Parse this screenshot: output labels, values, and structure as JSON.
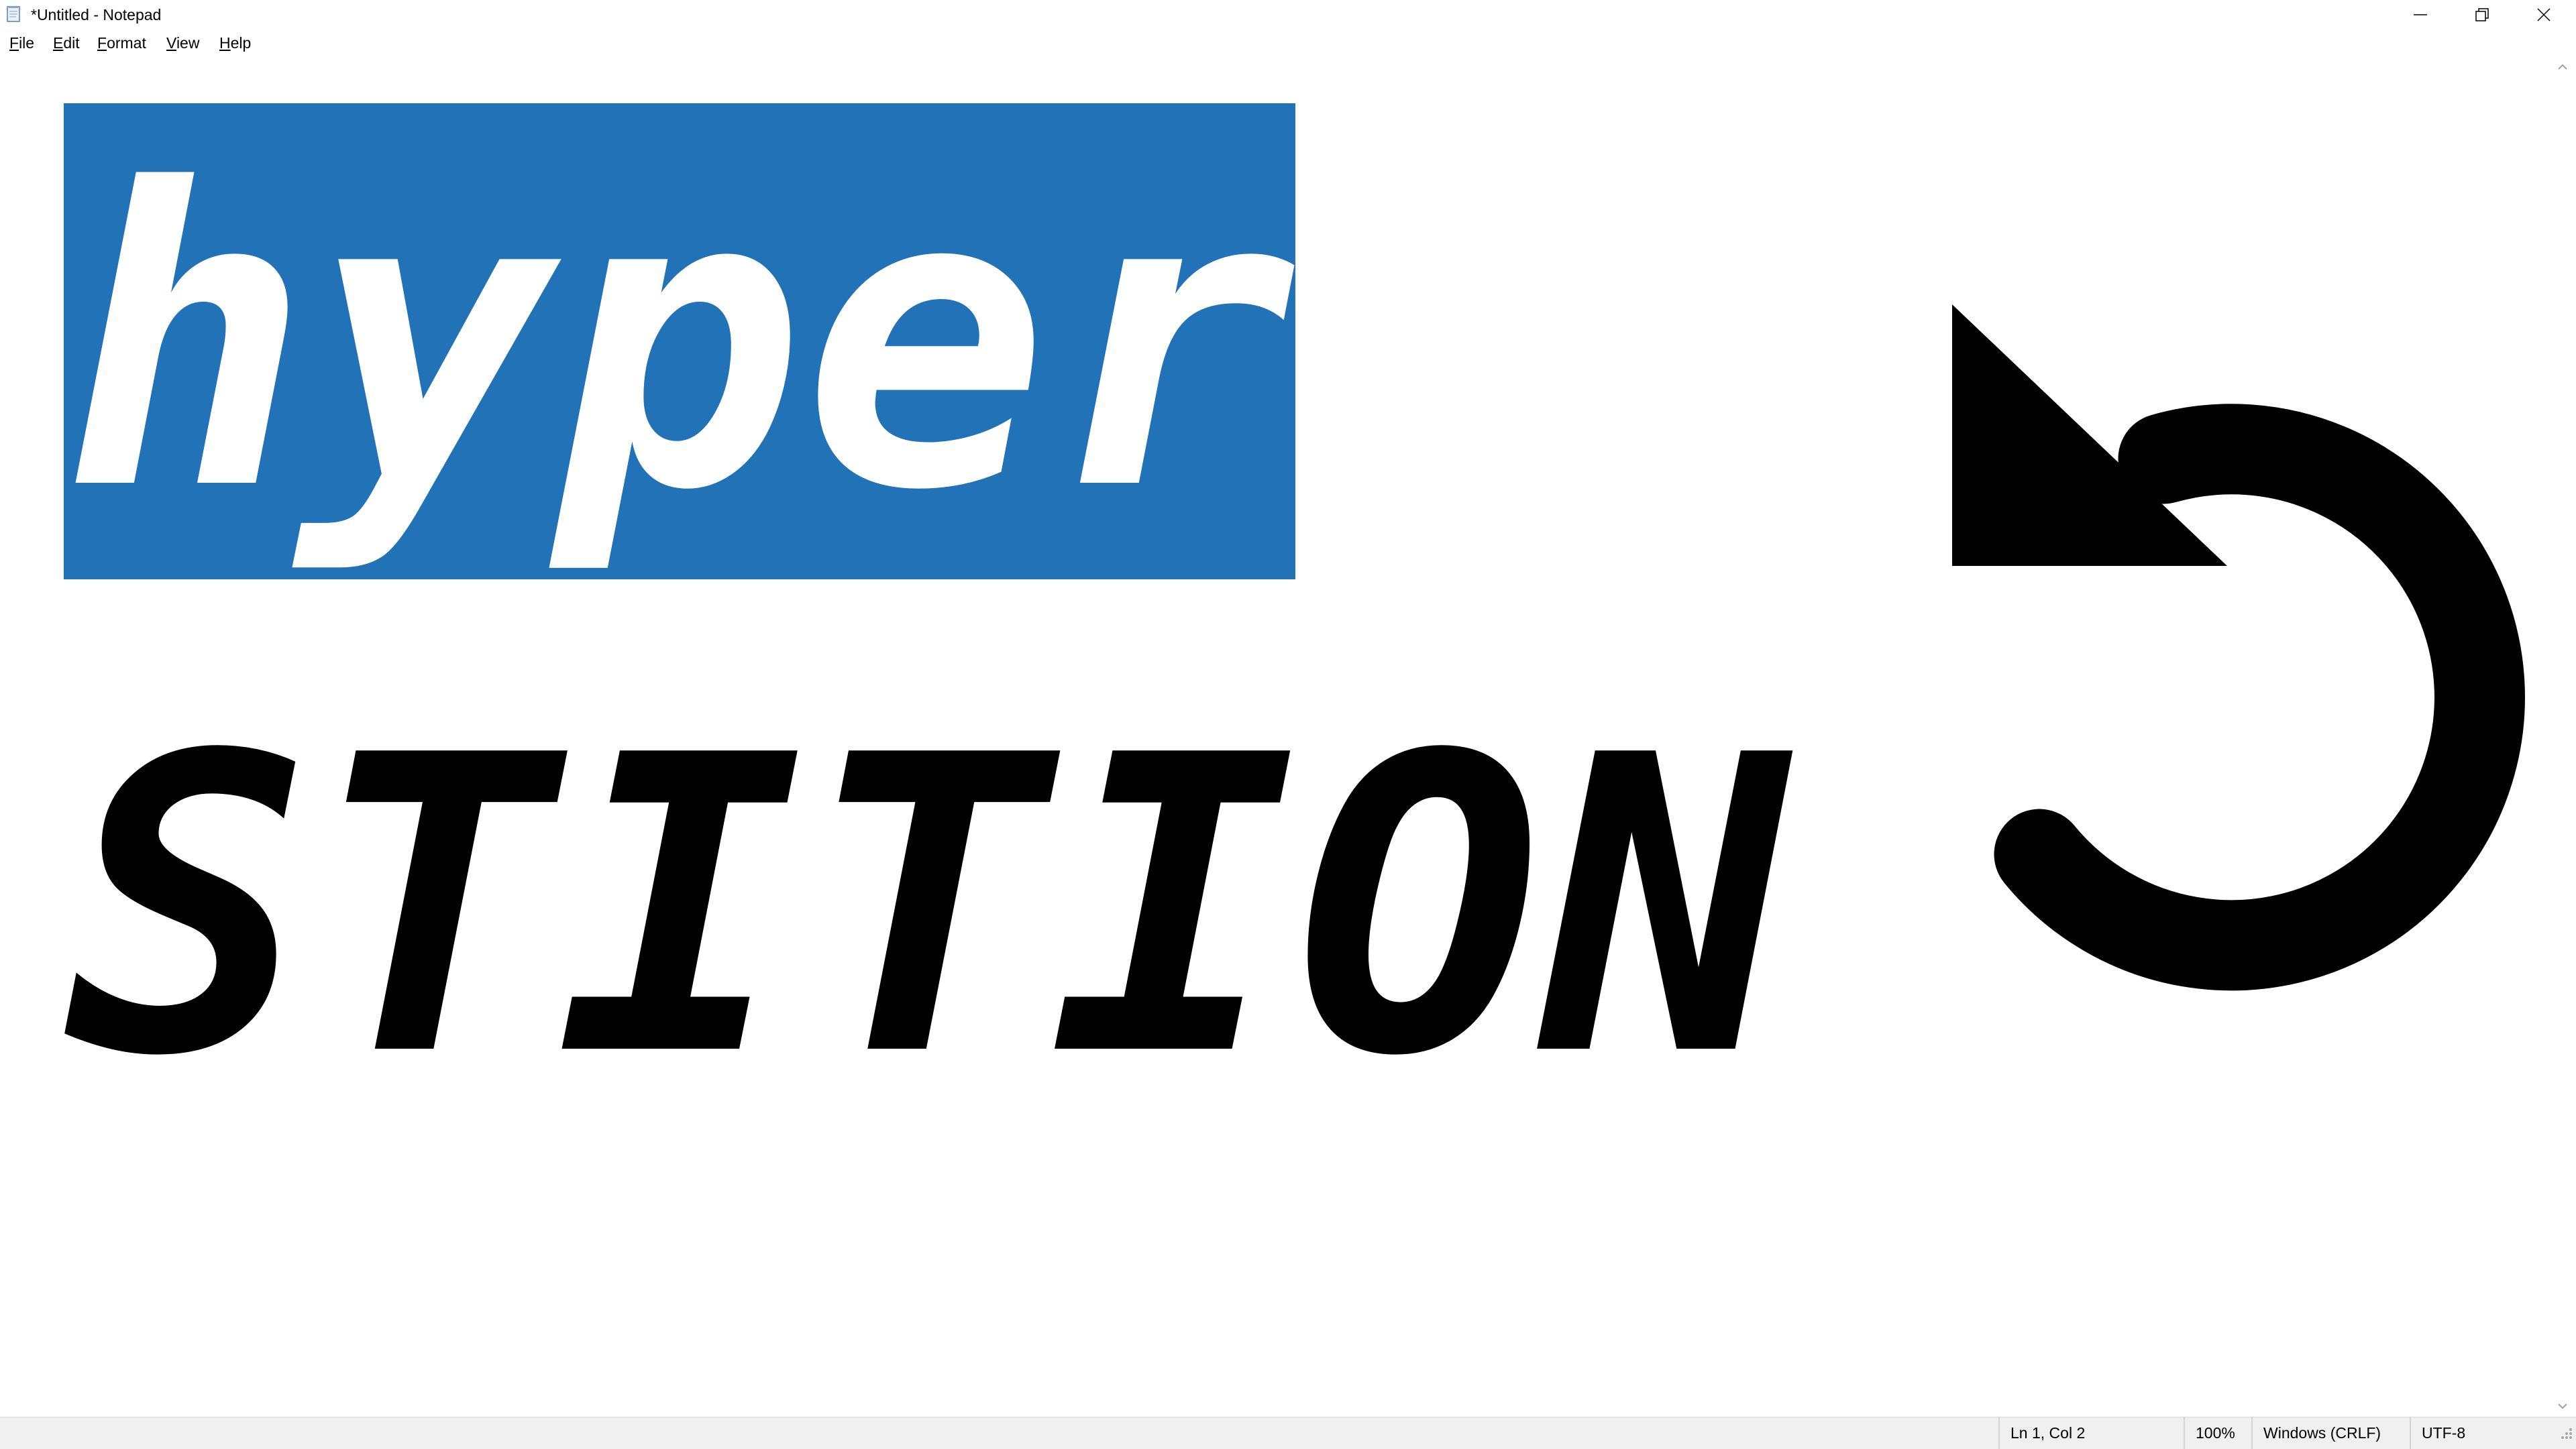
{
  "window": {
    "title": "*Untitled - Notepad",
    "app_icon": "notepad-icon",
    "controls": [
      "minimize-icon",
      "restore-icon",
      "close-icon"
    ]
  },
  "menu": {
    "items": [
      {
        "label": "File",
        "mnemonic": "F",
        "rest": "ile"
      },
      {
        "label": "Edit",
        "mnemonic": "E",
        "rest": "dit"
      },
      {
        "label": "Format",
        "mnemonic": "F",
        "rest": "ormat"
      },
      {
        "label": "View",
        "mnemonic": "V",
        "rest": "iew"
      },
      {
        "label": "Help",
        "mnemonic": "H",
        "rest": "elp"
      }
    ]
  },
  "editor": {
    "lines": [
      {
        "selected": "hyper",
        "unselected": ""
      },
      {
        "selected": "",
        "unselected": "STITION"
      }
    ],
    "side_glyph": "undo-arrow-icon",
    "selection_color": "#2272b8",
    "text_color": "#000000"
  },
  "status": {
    "position": "Ln 1, Col 2",
    "zoom": "100%",
    "line_ending": "Windows (CRLF)",
    "encoding": "UTF-8"
  }
}
